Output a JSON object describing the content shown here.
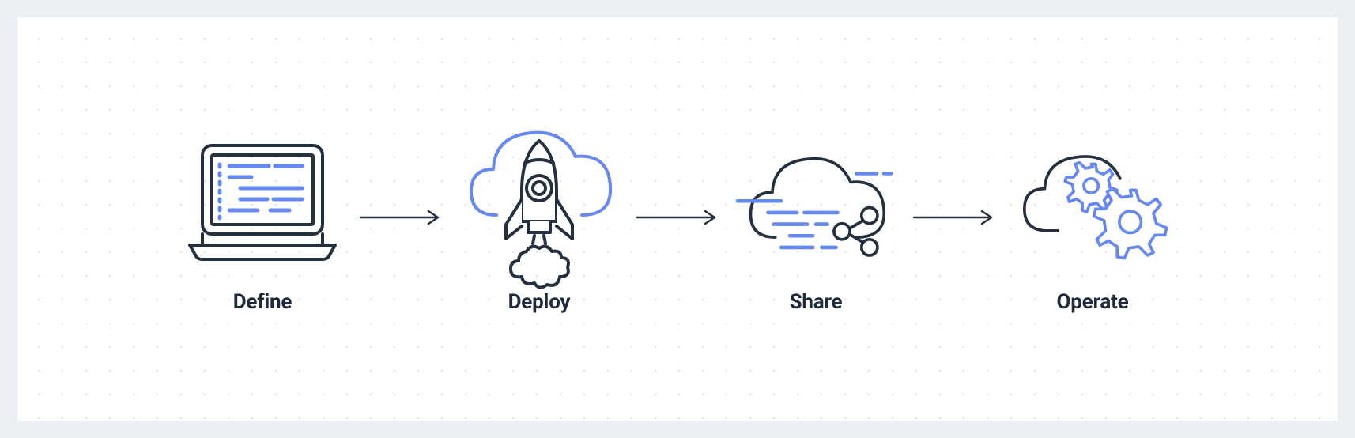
{
  "steps": [
    {
      "label": "Define",
      "icon": "laptop-code-icon"
    },
    {
      "label": "Deploy",
      "icon": "cloud-rocket-icon"
    },
    {
      "label": "Share",
      "icon": "cloud-share-icon"
    },
    {
      "label": "Operate",
      "icon": "cloud-gears-icon"
    }
  ],
  "colors": {
    "dark": "#25303f",
    "accent": "#6688f4",
    "arrow": "#25303f"
  }
}
